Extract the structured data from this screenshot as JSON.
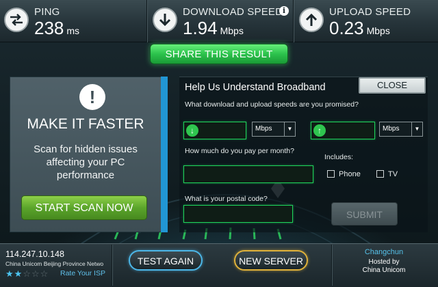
{
  "stats": {
    "ping": {
      "label": "PING",
      "value": "238",
      "unit": "ms"
    },
    "download": {
      "label": "DOWNLOAD SPEED",
      "value": "1.94",
      "unit": "Mbps",
      "info_icon": "i"
    },
    "upload": {
      "label": "UPLOAD SPEED",
      "value": "0.23",
      "unit": "Mbps"
    }
  },
  "share_button": "SHARE THIS RESULT",
  "promo": {
    "icon": "!",
    "title": "MAKE IT FASTER",
    "description": "Scan for hidden issues affecting your PC performance",
    "button": "START SCAN NOW"
  },
  "survey": {
    "title": "Help Us Understand Broadband",
    "close": "CLOSE",
    "question_speed": "What download and upload speeds are you promised?",
    "download_unit": "Mbps",
    "upload_unit": "Mbps",
    "question_pay": "How much do you pay per month?",
    "includes": "Includes:",
    "phone": "Phone",
    "tv": "TV",
    "question_postal": "What is your postal code?",
    "submit": "SUBMIT"
  },
  "bottom": {
    "ip": "114.247.10.148",
    "isp": "China Unicom Beijing Province Netwo",
    "rating": {
      "filled": 2,
      "total": 5
    },
    "rate_label": "Rate Your ISP",
    "test_again": "TEST AGAIN",
    "new_server": "NEW SERVER",
    "server_city": "Changchun",
    "hosted_by": "Hosted by",
    "host": "China Unicom"
  },
  "colors": {
    "accent_green": "#2cc24c",
    "accent_blue": "#4cb7e8",
    "accent_gold": "#e0b23a",
    "promo_stripe": "#2196d4"
  }
}
